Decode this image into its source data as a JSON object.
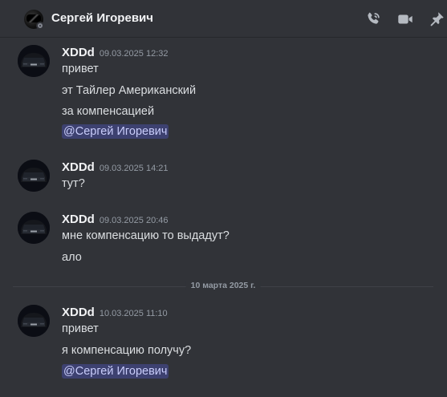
{
  "header": {
    "title": "Сергей Игоревич",
    "icons": [
      "phone-icon",
      "video-icon",
      "pin-icon"
    ]
  },
  "colors": {
    "background": "#313338",
    "mention_bg": "#3c4270",
    "mention_text": "#c9cdfb",
    "timestamp": "#949ba4"
  },
  "messages": [
    {
      "author": "XDDd",
      "timestamp": "09.03.2025 12:32",
      "lines": [
        "привет",
        "эт Тайлер Американский",
        "за компенсацией"
      ],
      "mention": "@Сергей Игоревич"
    },
    {
      "author": "XDDd",
      "timestamp": "09.03.2025 14:21",
      "lines": [
        "тут?"
      ]
    },
    {
      "author": "XDDd",
      "timestamp": "09.03.2025 20:46",
      "lines": [
        "мне компенсацию то выдадут?",
        "ало"
      ]
    },
    {
      "author": "XDDd",
      "timestamp": "10.03.2025 11:10",
      "lines": [
        "привет",
        "я компенсацию получу?"
      ],
      "mention": "@Сергей Игоревич"
    }
  ],
  "date_divider": "10 марта 2025 г."
}
